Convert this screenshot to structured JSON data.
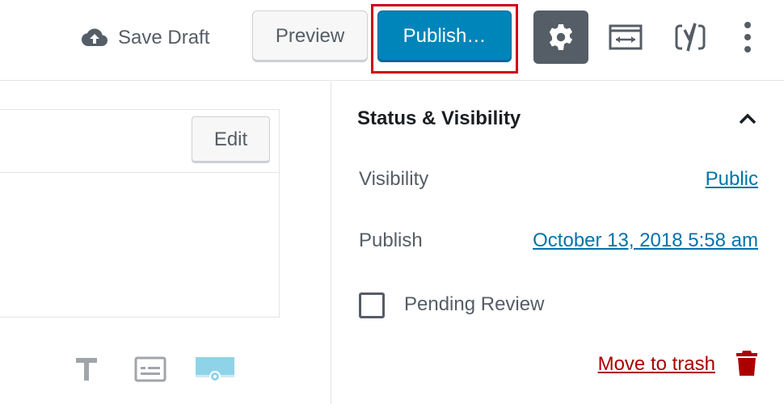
{
  "toolbar": {
    "save_draft_label": "Save Draft",
    "preview_label": "Preview",
    "publish_label": "Publish…",
    "icons": {
      "save_draft": "cloud-upload-icon",
      "settings": "gear-icon",
      "wide": "fullwidth-icon",
      "yoast": "yoast-icon",
      "more": "more-vertical-icon"
    },
    "colors": {
      "publish_bg": "#0085ba",
      "highlight": "#d0021b",
      "settings_bg": "#555d66"
    }
  },
  "editor": {
    "edit_label": "Edit",
    "tools": [
      "text-icon",
      "caption-icon",
      "media-icon"
    ]
  },
  "sidebar": {
    "panel_title": "Status & Visibility",
    "visibility_label": "Visibility",
    "visibility_value": "Public",
    "publish_label": "Publish",
    "publish_value": "October 13, 2018 5:58 am",
    "pending_review_label": "Pending Review",
    "pending_review_checked": false,
    "trash_label": "Move to trash",
    "colors": {
      "link": "#0073aa",
      "trash": "#a00"
    }
  }
}
